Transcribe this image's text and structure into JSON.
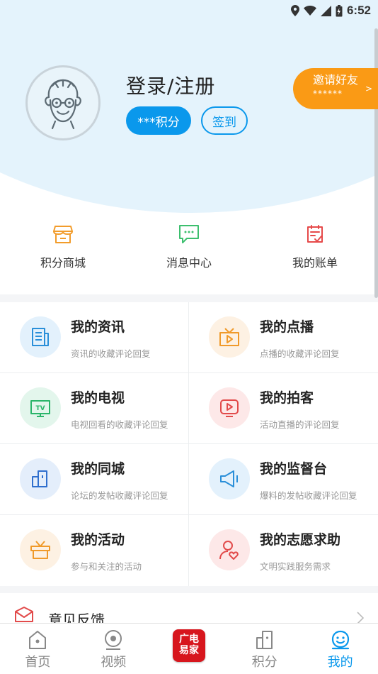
{
  "status_bar": {
    "time": "6:52"
  },
  "profile": {
    "login_title": "登录/注册",
    "points_label": "***积分",
    "checkin_label": "签到"
  },
  "invite": {
    "title": "邀请好友",
    "value": "******",
    "arrow": ">"
  },
  "quick_actions": [
    {
      "label": "积分商城",
      "icon": "store-icon",
      "color": "#f29c2b"
    },
    {
      "label": "消息中心",
      "icon": "message-icon",
      "color": "#3cbf6e"
    },
    {
      "label": "我的账单",
      "icon": "bill-icon",
      "color": "#e64a4a"
    }
  ],
  "grid": [
    {
      "title": "我的资讯",
      "subtitle": "资讯的收藏评论回复",
      "icon": "news-icon"
    },
    {
      "title": "我的点播",
      "subtitle": "点播的收藏评论回复",
      "icon": "vod-icon"
    },
    {
      "title": "我的电视",
      "subtitle": "电视回看的收藏评论回复",
      "icon": "tv-icon"
    },
    {
      "title": "我的拍客",
      "subtitle": "活动直播的评论回复",
      "icon": "camera-tv-icon"
    },
    {
      "title": "我的同城",
      "subtitle": "论坛的发帖收藏评论回复",
      "icon": "city-icon"
    },
    {
      "title": "我的监督台",
      "subtitle": "爆料的发帖收藏评论回复",
      "icon": "megaphone-icon"
    },
    {
      "title": "我的活动",
      "subtitle": "参与和关注的活动",
      "icon": "gift-icon"
    },
    {
      "title": "我的志愿求助",
      "subtitle": "文明实践服务需求",
      "icon": "volunteer-icon"
    }
  ],
  "feedback": {
    "label": "意见反馈"
  },
  "tabs": [
    {
      "label": "首页",
      "icon": "home-icon",
      "active": false
    },
    {
      "label": "视频",
      "icon": "video-icon",
      "active": false
    },
    {
      "label": "广电易家",
      "icon": "brand-logo",
      "active": false
    },
    {
      "label": "积分",
      "icon": "points-icon",
      "active": false
    },
    {
      "label": "我的",
      "icon": "profile-face-icon",
      "active": true
    }
  ],
  "colors": {
    "accent": "#0a98ec",
    "invite": "#fa9a15",
    "header_bg": "#e4f3fc"
  }
}
